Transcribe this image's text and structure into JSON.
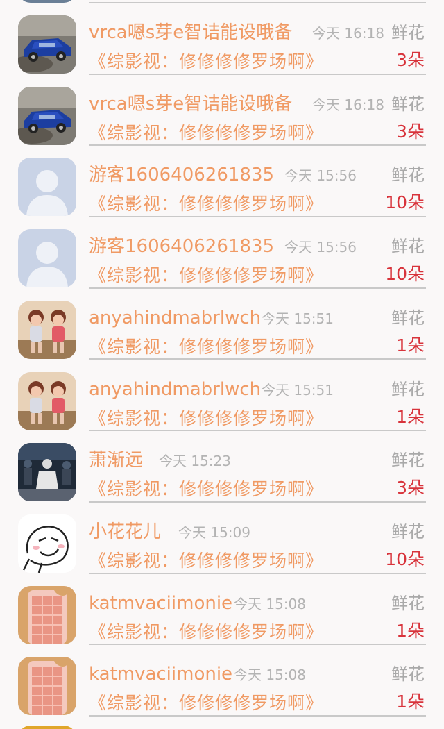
{
  "rows": [
    {
      "name": "vrca嗯s芽e智诘能设哦备",
      "time": "今天 16:18",
      "gift": "鲜花",
      "title": "《综影视：修修修修罗场啊》",
      "count": "3朵",
      "avatar": "car-avatar"
    },
    {
      "name": "vrca嗯s芽e智诘能设哦备",
      "time": "今天 16:18",
      "gift": "鲜花",
      "title": "《综影视：修修修修罗场啊》",
      "count": "3朵",
      "avatar": "car-avatar"
    },
    {
      "name": "游客1606406261835",
      "time": "今天 15:56",
      "gift": "鲜花",
      "title": "《综影视：修修修修罗场啊》",
      "count": "10朵",
      "avatar": "default-user-avatar"
    },
    {
      "name": "游客1606406261835",
      "time": "今天 15:56",
      "gift": "鲜花",
      "title": "《综影视：修修修修罗场啊》",
      "count": "10朵",
      "avatar": "default-user-avatar"
    },
    {
      "name": "anyahindmabrlwch",
      "time": "今天 15:51",
      "gift": "鲜花",
      "title": "《综影视：修修修修罗场啊》",
      "count": "1朵",
      "avatar": "kids-photo-avatar"
    },
    {
      "name": "anyahindmabrlwch",
      "time": "今天 15:51",
      "gift": "鲜花",
      "title": "《综影视：修修修修罗场啊》",
      "count": "1朵",
      "avatar": "kids-photo-avatar"
    },
    {
      "name": "萧渐远",
      "time": "今天 15:23",
      "gift": "鲜花",
      "title": "《综影视：修修修修罗场啊》",
      "count": "3朵",
      "avatar": "stage-photo-avatar"
    },
    {
      "name": "小花花儿",
      "time": "今天 15:09",
      "gift": "鲜花",
      "title": "《综影视：修修修修罗场啊》",
      "count": "10朵",
      "avatar": "sketch-face-avatar"
    },
    {
      "name": "katmvaciimonie",
      "time": "今天 15:08",
      "gift": "鲜花",
      "title": "《综影视：修修修修罗场啊》",
      "count": "1朵",
      "avatar": "chocolate-phone-avatar"
    },
    {
      "name": "katmvaciimonie",
      "time": "今天 15:08",
      "gift": "鲜花",
      "title": "《综影视：修修修修罗场啊》",
      "count": "1朵",
      "avatar": "chocolate-phone-avatar"
    }
  ],
  "colors": {
    "name_color": "#f09a64",
    "count_color": "#d8333b",
    "muted_color": "#b3b3b3",
    "divider_color": "#c9c9c9"
  }
}
